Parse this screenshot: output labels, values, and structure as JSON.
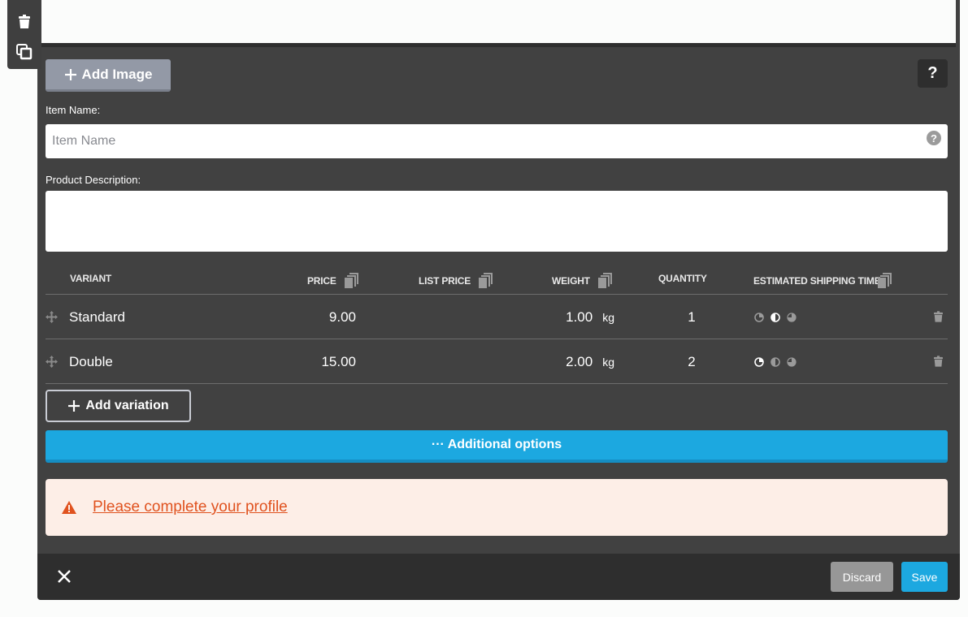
{
  "side_toolbar": {
    "delete_icon": "trash-icon",
    "duplicate_icon": "copy-icon"
  },
  "form": {
    "add_image_label": "Add Image",
    "help_label": "?",
    "item_name_label": "Item Name:",
    "item_name_placeholder": "Item Name",
    "item_name_value": "",
    "description_label": "Product Description:",
    "description_value": ""
  },
  "table": {
    "headers": {
      "variant": "VARIANT",
      "price": "PRICE",
      "list_price": "LIST PRICE",
      "weight": "WEIGHT",
      "quantity": "QUANTITY",
      "shipping": "ESTIMATED SHIPPING TIME"
    },
    "rows": [
      {
        "variant": "Standard",
        "price": "9.00",
        "list_price": "",
        "weight": "1.00",
        "unit": "kg",
        "quantity": "1",
        "shipping_selected": 1
      },
      {
        "variant": "Double",
        "price": "15.00",
        "list_price": "",
        "weight": "2.00",
        "unit": "kg",
        "quantity": "2",
        "shipping_selected": 0
      }
    ]
  },
  "actions": {
    "add_variation_label": "Add variation",
    "additional_options_label": "··· Additional options"
  },
  "alert": {
    "text": "Please complete your profile",
    "color": "#e0521f"
  },
  "footer": {
    "discard_label": "Discard",
    "save_label": "Save"
  },
  "colors": {
    "accent": "#1ca8e0",
    "panel": "#414141",
    "footer": "#2e2e2e"
  }
}
